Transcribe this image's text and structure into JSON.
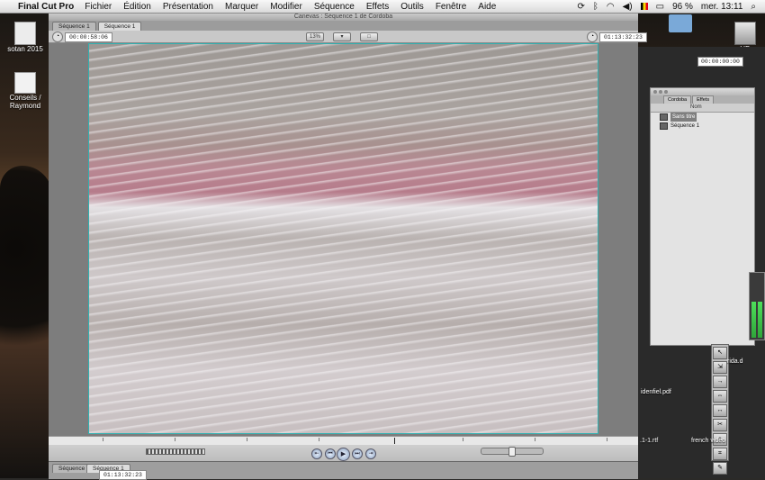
{
  "menubar": {
    "app_name": "Final Cut Pro",
    "items": [
      "Fichier",
      "Édition",
      "Présentation",
      "Marquer",
      "Modifier",
      "Séquence",
      "Effets",
      "Outils",
      "Fenêtre",
      "Aide"
    ],
    "battery": "96 %",
    "clock": "mer. 13:11"
  },
  "desktop": {
    "icons": [
      {
        "label": "sotan 2015"
      },
      {
        "label": "Conseils / Raymond"
      },
      {
        "label": "HD"
      }
    ],
    "files": [
      "idenfiel.pdf",
      ".1-1.rtf",
      "french video",
      "rida.d"
    ]
  },
  "canvas": {
    "title": "Canevas : Séquence 1 de Cordoba",
    "tabs": [
      "Séquence 1",
      "Séquence 1"
    ],
    "timecode_left": "00:00:58:06",
    "timecode_right": "01:13:32:23",
    "zoom_label": "13%",
    "view_label": "▾"
  },
  "browser": {
    "timecode": "00:00:00:00",
    "tabs": [
      "Cordoba",
      "Effets"
    ],
    "column_header": "Nom",
    "items": [
      {
        "name": "Sans titre",
        "selected": true
      },
      {
        "name": "Séquence 1",
        "selected": false
      }
    ]
  },
  "timeline": {
    "tabs": [
      "Séquence 1",
      "Séquence 1"
    ],
    "timecode": "01:13:32:23"
  },
  "colors": {
    "video_border": "#2fb1b1",
    "meter_green": "#4de05a"
  }
}
